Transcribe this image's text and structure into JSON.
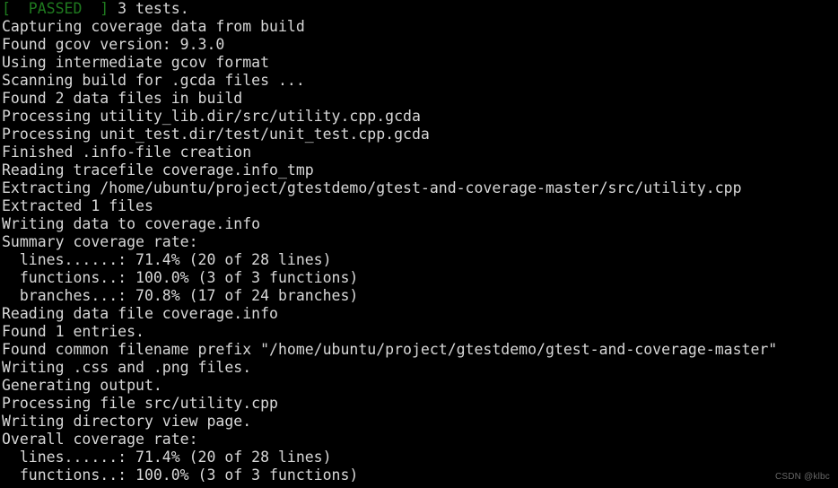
{
  "terminal": {
    "background_color": "#000000",
    "text_color": "#d8d8d8",
    "accent_pass_color": "#1f7a1f",
    "lines": [
      {
        "id": "line-1",
        "segments": [
          {
            "text": "[  PASSED  ]",
            "color": "green"
          },
          {
            "text": " 3 tests.",
            "color": "default"
          }
        ]
      },
      {
        "id": "line-2",
        "segments": [
          {
            "text": "Capturing coverage data from build",
            "color": "default"
          }
        ]
      },
      {
        "id": "line-3",
        "segments": [
          {
            "text": "Found gcov version: 9.3.0",
            "color": "default"
          }
        ]
      },
      {
        "id": "line-4",
        "segments": [
          {
            "text": "Using intermediate gcov format",
            "color": "default"
          }
        ]
      },
      {
        "id": "line-5",
        "segments": [
          {
            "text": "Scanning build for .gcda files ...",
            "color": "default"
          }
        ]
      },
      {
        "id": "line-6",
        "segments": [
          {
            "text": "Found 2 data files in build",
            "color": "default"
          }
        ]
      },
      {
        "id": "line-7",
        "segments": [
          {
            "text": "Processing utility_lib.dir/src/utility.cpp.gcda",
            "color": "default"
          }
        ]
      },
      {
        "id": "line-8",
        "segments": [
          {
            "text": "Processing unit_test.dir/test/unit_test.cpp.gcda",
            "color": "default"
          }
        ]
      },
      {
        "id": "line-9",
        "segments": [
          {
            "text": "Finished .info-file creation",
            "color": "default"
          }
        ]
      },
      {
        "id": "line-10",
        "segments": [
          {
            "text": "Reading tracefile coverage.info_tmp",
            "color": "default"
          }
        ]
      },
      {
        "id": "line-11",
        "segments": [
          {
            "text": "Extracting /home/ubuntu/project/gtestdemo/gtest-and-coverage-master/src/utility.cpp",
            "color": "default"
          }
        ]
      },
      {
        "id": "line-12",
        "segments": [
          {
            "text": "Extracted 1 files",
            "color": "default"
          }
        ]
      },
      {
        "id": "line-13",
        "segments": [
          {
            "text": "Writing data to coverage.info",
            "color": "default"
          }
        ]
      },
      {
        "id": "line-14",
        "segments": [
          {
            "text": "Summary coverage rate:",
            "color": "default"
          }
        ]
      },
      {
        "id": "line-15",
        "segments": [
          {
            "text": "  lines......: 71.4% (20 of 28 lines)",
            "color": "default"
          }
        ]
      },
      {
        "id": "line-16",
        "segments": [
          {
            "text": "  functions..: 100.0% (3 of 3 functions)",
            "color": "default"
          }
        ]
      },
      {
        "id": "line-17",
        "segments": [
          {
            "text": "  branches...: 70.8% (17 of 24 branches)",
            "color": "default"
          }
        ]
      },
      {
        "id": "line-18",
        "segments": [
          {
            "text": "Reading data file coverage.info",
            "color": "default"
          }
        ]
      },
      {
        "id": "line-19",
        "segments": [
          {
            "text": "Found 1 entries.",
            "color": "default"
          }
        ]
      },
      {
        "id": "line-20",
        "segments": [
          {
            "text": "Found common filename prefix \"/home/ubuntu/project/gtestdemo/gtest-and-coverage-master\"",
            "color": "default"
          }
        ]
      },
      {
        "id": "line-21",
        "segments": [
          {
            "text": "Writing .css and .png files.",
            "color": "default"
          }
        ]
      },
      {
        "id": "line-22",
        "segments": [
          {
            "text": "Generating output.",
            "color": "default"
          }
        ]
      },
      {
        "id": "line-23",
        "segments": [
          {
            "text": "Processing file src/utility.cpp",
            "color": "default"
          }
        ]
      },
      {
        "id": "line-24",
        "segments": [
          {
            "text": "Writing directory view page.",
            "color": "default"
          }
        ]
      },
      {
        "id": "line-25",
        "segments": [
          {
            "text": "Overall coverage rate:",
            "color": "default"
          }
        ]
      },
      {
        "id": "line-26",
        "segments": [
          {
            "text": "  lines......: 71.4% (20 of 28 lines)",
            "color": "default"
          }
        ]
      },
      {
        "id": "line-27",
        "segments": [
          {
            "text": "  functions..: 100.0% (3 of 3 functions)",
            "color": "default"
          }
        ]
      }
    ]
  },
  "watermark": {
    "text": "CSDN @klbc"
  },
  "coverage": {
    "summary": {
      "label": "Summary coverage rate:",
      "lines": {
        "label": "lines......:",
        "percent": "71.4%",
        "covered": 20,
        "total": 28,
        "unit": "lines"
      },
      "functions": {
        "label": "functions..:",
        "percent": "100.0%",
        "covered": 3,
        "total": 3,
        "unit": "functions"
      },
      "branches": {
        "label": "branches...:",
        "percent": "70.8%",
        "covered": 17,
        "total": 24,
        "unit": "branches"
      }
    },
    "overall": {
      "label": "Overall coverage rate:",
      "lines": {
        "label": "lines......:",
        "percent": "71.4%",
        "covered": 20,
        "total": 28,
        "unit": "lines"
      },
      "functions": {
        "label": "functions..:",
        "percent": "100.0%",
        "covered": 3,
        "total": 3,
        "unit": "functions"
      }
    }
  },
  "test_result": {
    "status": "[  PASSED  ]",
    "detail": " 3 tests.",
    "count": 3
  },
  "environment": {
    "gcov_version": "9.3.0",
    "data_files_found": 2,
    "entries_found": 1,
    "common_prefix": "/home/ubuntu/project/gtestdemo/gtest-and-coverage-master"
  }
}
